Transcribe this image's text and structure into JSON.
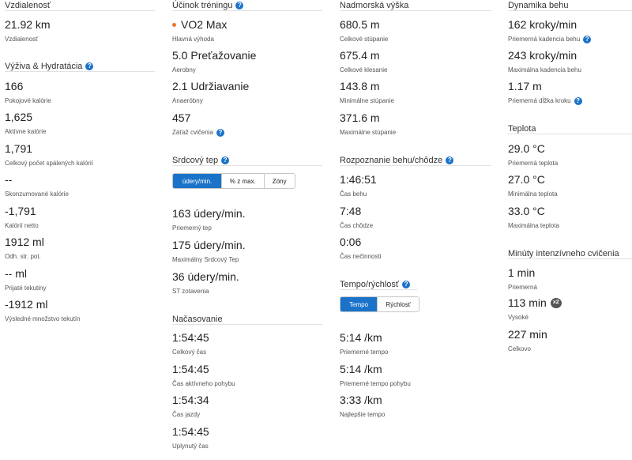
{
  "col1": {
    "distance_title": "Vzdialenosť",
    "distance_value": "21.92 km",
    "distance_label": "Vzdialenosť",
    "nutrition_title": "Výživa & Hydratácia",
    "stats": [
      {
        "value": "166",
        "label": "Pokojové kalórie"
      },
      {
        "value": "1,625",
        "label": "Aktívne kalórie"
      },
      {
        "value": "1,791",
        "label": "Celkový počet spálených kalórií"
      },
      {
        "value": "--",
        "label": "Skonzumované kalórie"
      },
      {
        "value": "-1,791",
        "label": "Kalórií netto"
      },
      {
        "value": "1912 ml",
        "label": "Odh. str. pot."
      },
      {
        "value": "-- ml",
        "label": "Prijaté tekutiny"
      },
      {
        "value": "-1912 ml",
        "label": "Výsledné množstvo tekutín"
      }
    ]
  },
  "col2": {
    "training_title": "Účinok tréningu",
    "training": [
      {
        "value": "VO2 Max",
        "label": "Hlavná výhoda"
      },
      {
        "value": "5.0 Preťažovanie",
        "label": "Aerobny"
      },
      {
        "value": "2.1 Udržiavanie",
        "label": "Anaeróbny"
      },
      {
        "value": "457",
        "label": "Záťaž cvičenia"
      }
    ],
    "hr_title": "Srdcový tep",
    "hr_tabs": [
      "údery/min.",
      "% z max.",
      "Zóny"
    ],
    "hr": [
      {
        "value": "163 údery/min.",
        "label": "Priemerný tep"
      },
      {
        "value": "175 údery/min.",
        "label": "Maximálny Srdcový Tep"
      },
      {
        "value": "36 údery/min.",
        "label": "ST zotavenia"
      }
    ],
    "timing_title": "Načasovanie",
    "timing": [
      {
        "value": "1:54:45",
        "label": "Celkový čas"
      },
      {
        "value": "1:54:45",
        "label": "Čas aktívneho pohybu"
      },
      {
        "value": "1:54:34",
        "label": "Čas jazdy"
      },
      {
        "value": "1:54:45",
        "label": "Uplynutý čas"
      }
    ]
  },
  "col3": {
    "elev_title": "Nadmorská výška",
    "elev": [
      {
        "value": "680.5 m",
        "label": "Celkové stúpanie"
      },
      {
        "value": "675.4 m",
        "label": "Celkové klesanie"
      },
      {
        "value": "143.8 m",
        "label": "Minimálne stúpanie"
      },
      {
        "value": "371.6 m",
        "label": "Maximálne stúpanie"
      }
    ],
    "runwalk_title": "Rozpoznanie behu/chôdze",
    "runwalk": [
      {
        "value": "1:46:51",
        "label": "Čas behu"
      },
      {
        "value": "7:48",
        "label": "Čas chôdze"
      },
      {
        "value": "0:06",
        "label": "Čas nečinnosti"
      }
    ],
    "pace_title": "Tempo/rýchlosť",
    "pace_tabs": [
      "Tempo",
      "Rýchlosť"
    ],
    "pace": [
      {
        "value": "5:14 /km",
        "label": "Priemerné tempo"
      },
      {
        "value": "5:14 /km",
        "label": "Priemerné tempo pohybu"
      },
      {
        "value": "3:33 /km",
        "label": "Najlepšie tempo"
      }
    ]
  },
  "col4": {
    "dyn_title": "Dynamika behu",
    "dyn": [
      {
        "value": "162 kroky/min",
        "label": "Priemerná kadencia behu"
      },
      {
        "value": "243 kroky/min",
        "label": "Maximálna kadencia behu"
      },
      {
        "value": "1.17 m",
        "label": "Priemerná dĺžka kroku"
      }
    ],
    "temp_title": "Teplota",
    "temp": [
      {
        "value": "29.0 °C",
        "label": "Priemerná teplota"
      },
      {
        "value": "27.0 °C",
        "label": "Minimálna teplota"
      },
      {
        "value": "33.0 °C",
        "label": "Maximálna teplota"
      }
    ],
    "intensity_title": "Minúty intenzívneho cvičenia",
    "intensity": [
      {
        "value": "1 min",
        "label": "Priemerná"
      },
      {
        "value": "113 min",
        "label": "Vysoké",
        "badge": "x2"
      },
      {
        "value": "227 min",
        "label": "Celkovo"
      }
    ]
  },
  "info_glyph": "?",
  "colors": {
    "accent": "#1a73c9",
    "dot": "#e8762c",
    "badge": "#555555"
  }
}
